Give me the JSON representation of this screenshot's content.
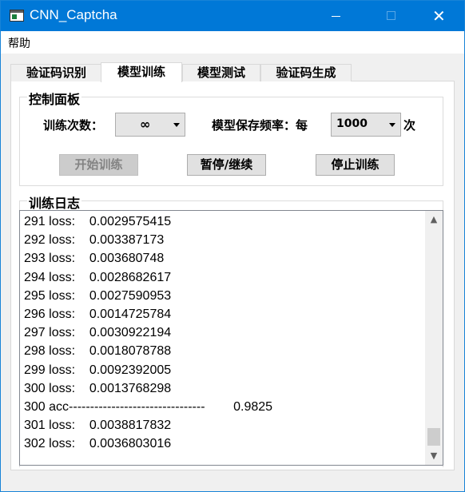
{
  "window": {
    "title": "CNN_Captcha"
  },
  "titlebar": {
    "close_glyph": "✕"
  },
  "menu": {
    "items": [
      {
        "label": "帮助"
      }
    ]
  },
  "tabs": [
    {
      "label": "验证码识别",
      "active": false
    },
    {
      "label": "模型训练",
      "active": true
    },
    {
      "label": "模型测试",
      "active": false
    },
    {
      "label": "验证码生成",
      "active": false
    }
  ],
  "control_panel": {
    "title": "控制面板",
    "train_count_label": "训练次数：",
    "train_count_value": "∞",
    "save_freq_label": "模型保存频率：每",
    "save_freq_value": "1000",
    "save_freq_suffix": "次",
    "start_button": "开始训练",
    "pause_button": "暂停/继续",
    "stop_button": "停止训练"
  },
  "log_panel": {
    "title": "训练日志",
    "lines": [
      "291 loss:    0.0029575415",
      "292 loss:    0.003387173",
      "293 loss:    0.003680748",
      "294 loss:    0.0028682617",
      "295 loss:    0.0027590953",
      "296 loss:    0.0014725784",
      "297 loss:    0.0030922194",
      "298 loss:    0.0018078788",
      "299 loss:    0.0092392005",
      "300 loss:    0.0013768298",
      "300 acc--------------------------------        0.9825",
      "301 loss:    0.0038817832",
      "302 loss:    0.0036803016"
    ]
  },
  "colors": {
    "titlebar": "#0078d7",
    "disabled_text": "#838383"
  },
  "icons": {
    "app": "app-window-icon",
    "minimize": "minimize-icon",
    "maximize": "maximize-icon",
    "close": "close-icon",
    "dropdown": "chevron-down-icon",
    "scroll_up": "scroll-up-arrow-icon",
    "scroll_down": "scroll-down-arrow-icon"
  }
}
